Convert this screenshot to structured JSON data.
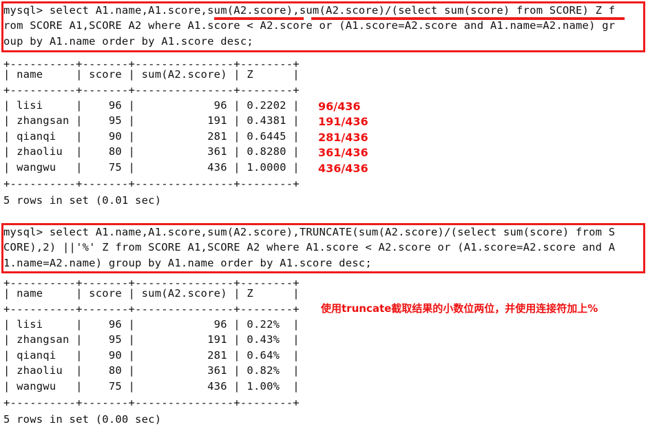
{
  "terminal": {
    "prompt": "mysql>",
    "query1": {
      "lines": [
        "mysql> select A1.name,A1.score,sum(A2.score),sum(A2.score)/(select sum(score) from SCORE) Z f",
        "rom SCORE A1,SCORE A2 where A1.score < A2.score or (A1.score=A2.score and A1.name=A2.name) gr",
        "oup by A1.name order by A1.score desc;"
      ]
    },
    "result1": {
      "lines": [
        "+----------+-------+---------------+--------+",
        "| name     | score | sum(A2.score) | Z      |",
        "+----------+-------+---------------+--------+",
        "| lisi     |    96 |            96 | 0.2202 |",
        "| zhangsan |    95 |           191 | 0.4381 |",
        "| qianqi   |    90 |           281 | 0.6445 |",
        "| zhaoliu  |    80 |           361 | 0.8280 |",
        "| wangwu   |    75 |           436 | 1.0000 |",
        "+----------+-------+---------------+--------+"
      ],
      "status": "5 rows in set (0.01 sec)"
    },
    "query2": {
      "lines": [
        "mysql> select A1.name,A1.score,sum(A2.score),TRUNCATE(sum(A2.score)/(select sum(score) from S",
        "CORE),2) ||'%' Z from SCORE A1,SCORE A2 where A1.score < A2.score or (A1.score=A2.score and A",
        "1.name=A2.name) group by A1.name order by A1.score desc;"
      ]
    },
    "result2": {
      "lines": [
        "+----------+-------+---------------+--------+",
        "| name     | score | sum(A2.score) | Z      |",
        "+----------+-------+---------------+--------+",
        "| lisi     |    96 |            96 | 0.22%  |",
        "| zhangsan |    95 |           191 | 0.43%  |",
        "| qianqi   |    90 |           281 | 0.64%  |",
        "| zhaoliu  |    80 |           361 | 0.82%  |",
        "| wangwu   |    75 |           436 | 1.00%  |",
        "+----------+-------+---------------+--------+"
      ],
      "status": "5 rows in set (0.00 sec)"
    }
  },
  "tables": {
    "headers": [
      "name",
      "score",
      "sum(A2.score)",
      "Z"
    ],
    "rows1": [
      {
        "name": "lisi",
        "score": "96",
        "sum": "96",
        "z": "0.2202"
      },
      {
        "name": "zhangsan",
        "score": "95",
        "sum": "191",
        "z": "0.4381"
      },
      {
        "name": "qianqi",
        "score": "90",
        "sum": "281",
        "z": "0.6445"
      },
      {
        "name": "zhaoliu",
        "score": "80",
        "sum": "361",
        "z": "0.8280"
      },
      {
        "name": "wangwu",
        "score": "75",
        "sum": "436",
        "z": "1.0000"
      }
    ],
    "rows2": [
      {
        "name": "lisi",
        "score": "96",
        "sum": "96",
        "z": "0.22%"
      },
      {
        "name": "zhangsan",
        "score": "95",
        "sum": "191",
        "z": "0.43%"
      },
      {
        "name": "qianqi",
        "score": "90",
        "sum": "281",
        "z": "0.64%"
      },
      {
        "name": "zhaoliu",
        "score": "80",
        "sum": "361",
        "z": "0.82%"
      },
      {
        "name": "wangwu",
        "score": "75",
        "sum": "436",
        "z": "1.00%"
      }
    ]
  },
  "annotations": {
    "fractions": [
      "96/436",
      "191/436",
      "281/436",
      "361/436",
      "436/436"
    ],
    "note": "使用truncate截取结果的小数位两位，并使用连接符加上%"
  },
  "colors": {
    "annotation_red": "#ee1111",
    "box_red": "#ef1b1b",
    "text": "#111111",
    "background": "#ffffff"
  }
}
